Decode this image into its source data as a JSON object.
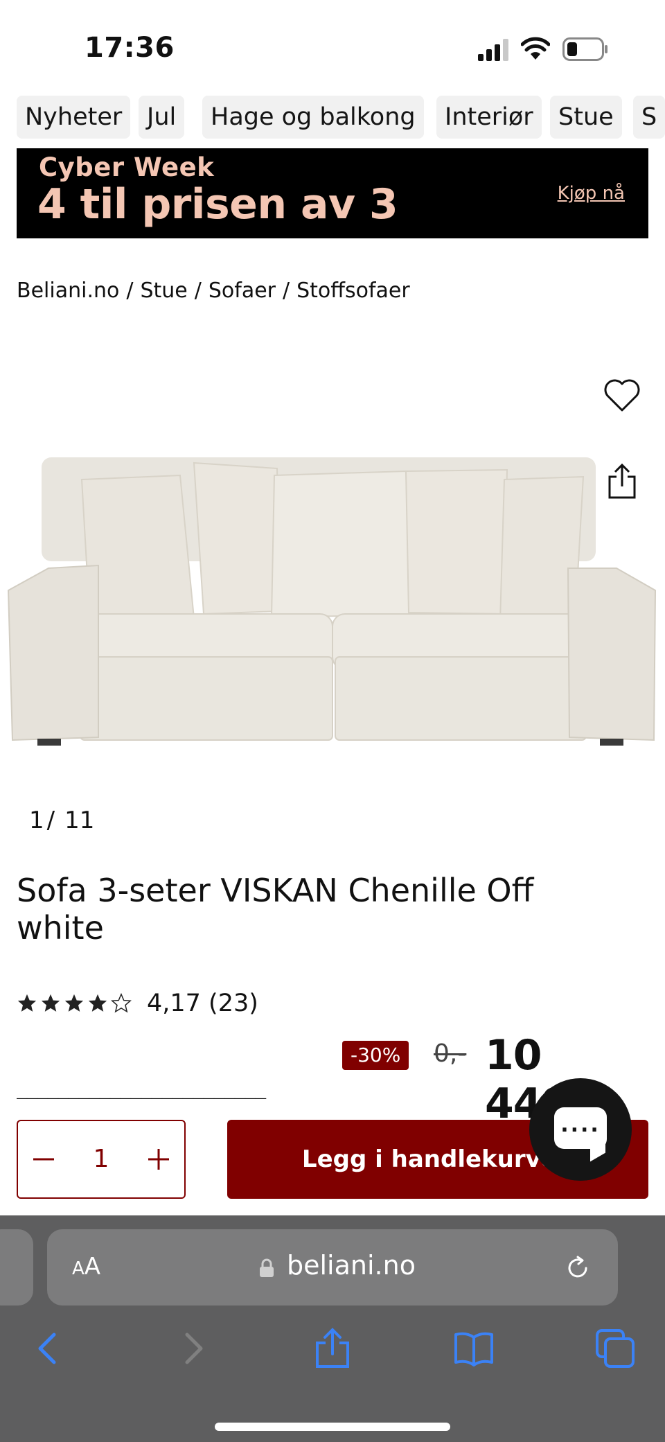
{
  "status_bar": {
    "time": "17:36"
  },
  "categories": [
    "Nyheter",
    "Jul",
    "Hage og balkong",
    "Interiør",
    "Stue",
    "S"
  ],
  "banner": {
    "line1": "Cyber Week",
    "line2": "4 til prisen av 3",
    "cta": "Kjøp nå"
  },
  "breadcrumb": [
    "Beliani.no",
    "Stue",
    "Sofaer",
    "Stoffsofaer"
  ],
  "gallery": {
    "current": "1",
    "total": "11"
  },
  "product": {
    "title": "Sofa 3-seter VISKAN Chenille Off white",
    "rating_value": 4.17,
    "rating_text": "4,17 (23)",
    "discount": "-30%",
    "old_price": "0,-",
    "price": "10 449,-"
  },
  "cart": {
    "quantity": "1",
    "add_label": "Legg i handlekurven"
  },
  "browser": {
    "aa_label": "AA",
    "url": "beliani.no"
  },
  "icons": [
    "heart-icon",
    "share-icon",
    "star-icon",
    "minus-icon",
    "plus-icon",
    "chat-icon",
    "lock-icon",
    "reload-icon",
    "back-icon",
    "forward-icon",
    "share-sheet-icon",
    "bookmarks-icon",
    "tabs-icon"
  ],
  "colors": {
    "brand": "#800000",
    "banner_bg": "#000000",
    "banner_text": "#f4c6b3",
    "safari_bar": "#5e5e5f",
    "safari_accent": "#3b82f6"
  }
}
